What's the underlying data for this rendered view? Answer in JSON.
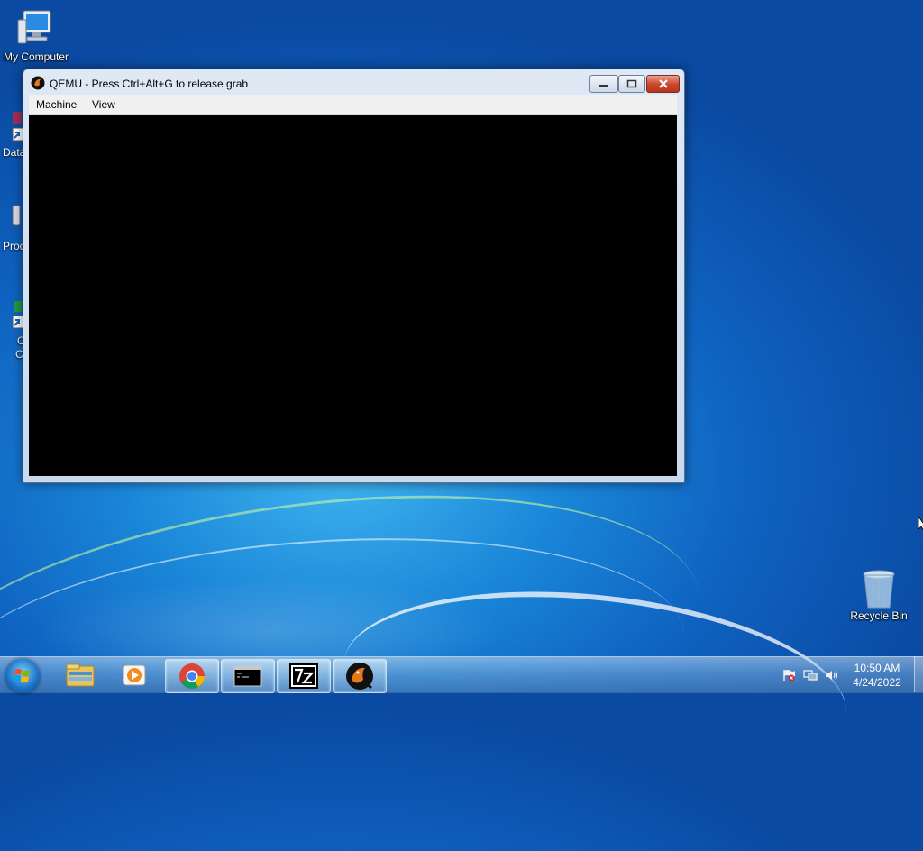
{
  "desktop": {
    "icons": [
      {
        "label": "My Computer"
      },
      {
        "label": "Recycle Bin"
      }
    ],
    "partial_labels": [
      "Data",
      "Proc",
      "C",
      "C"
    ]
  },
  "window": {
    "title": "QEMU - Press Ctrl+Alt+G to release grab",
    "menu": [
      "Machine",
      "View"
    ]
  },
  "taskbar": {
    "icons": [
      "windows-explorer-icon",
      "media-player-icon",
      "chrome-icon",
      "command-prompt-icon",
      "7zip-icon",
      "qemu-icon"
    ],
    "tray": {
      "time": "10:50 AM",
      "date": "4/24/2022"
    }
  }
}
